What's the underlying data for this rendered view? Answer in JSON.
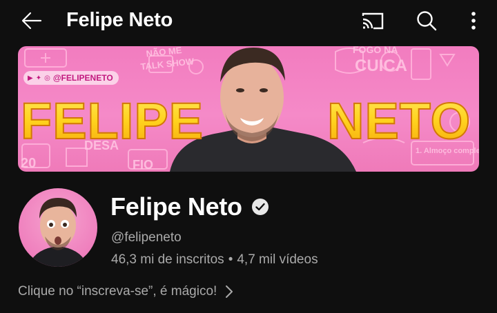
{
  "header": {
    "title": "Felipe Neto",
    "back_icon": "arrow-left-icon",
    "actions": [
      {
        "icon": "cast-icon"
      },
      {
        "icon": "search-icon"
      },
      {
        "icon": "more-vertical-icon"
      }
    ]
  },
  "banner": {
    "social_handle": "@FELIPENETO",
    "word_left": "FELIPE",
    "word_right": "NETO",
    "background_color": "#f27cbf",
    "title_color": "#ffd21e"
  },
  "channel": {
    "name": "Felipe Neto",
    "verified": true,
    "handle": "@felipeneto",
    "subscribers": "46,3 mi de inscritos",
    "separator": "•",
    "videos": "4,7 mil vídeos",
    "description": "Clique no “inscreva-se”, é mágico!"
  },
  "colors": {
    "background": "#0f0f0f",
    "primary_text": "#ffffff",
    "secondary_text": "#aaaaaa"
  }
}
